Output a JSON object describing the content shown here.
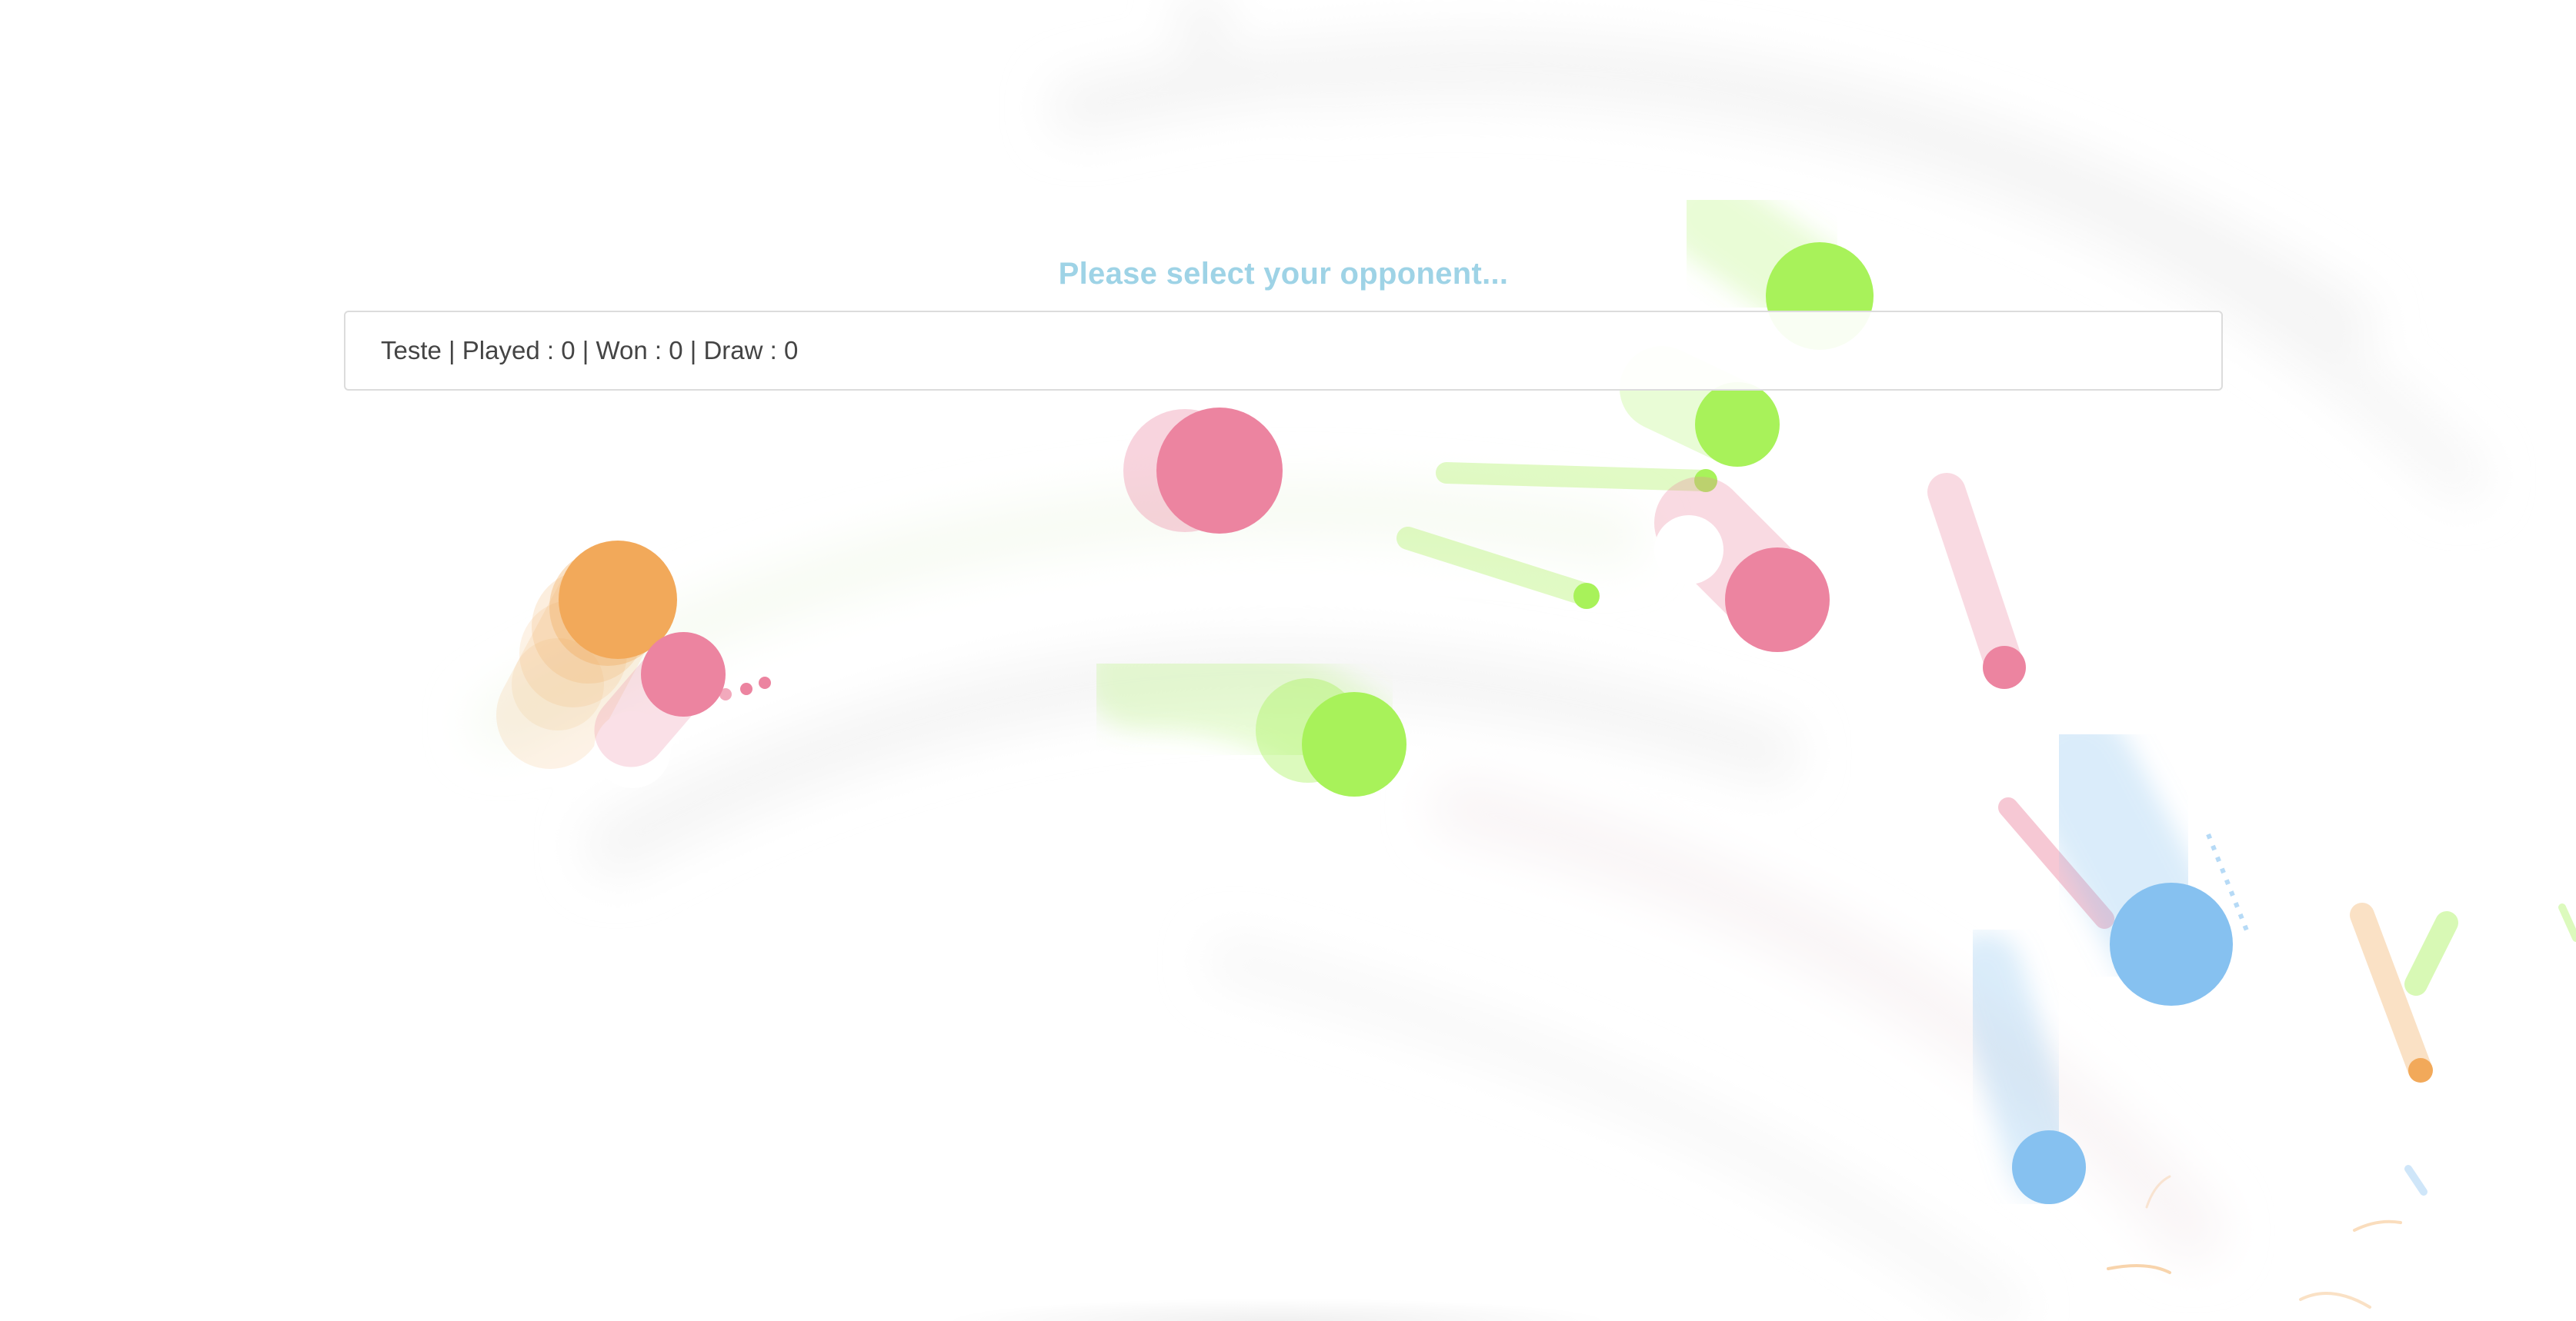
{
  "screen": {
    "title": "Please select your opponent..."
  },
  "opponents": [
    {
      "text": "Teste | Played : 0 | Won : 0 | Draw : 0"
    }
  ],
  "colors": {
    "title": "#9ed3e6",
    "ball_green": "#a8f25a",
    "ball_pink": "#ec84a0",
    "ball_orange": "#f2a95a",
    "ball_blue": "#86c1f0"
  }
}
